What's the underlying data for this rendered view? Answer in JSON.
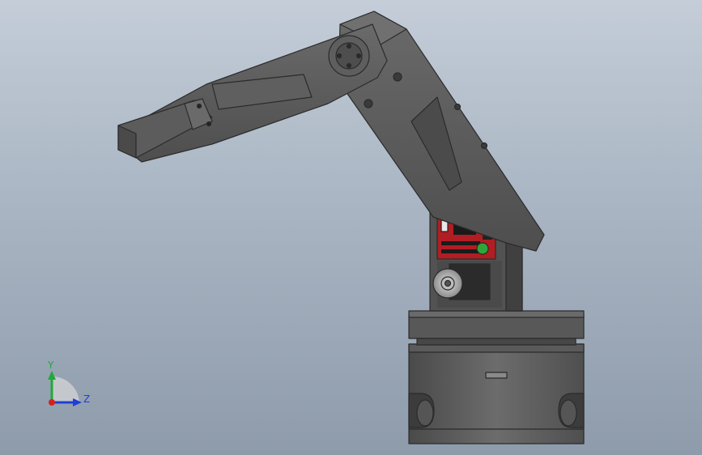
{
  "viewport": {
    "background_top": "#c4cdd8",
    "background_bottom": "#8e9bab"
  },
  "model": {
    "body_color": "#5b5b5b",
    "pcb_color": "#b01e23",
    "led_color": "#2fa83a"
  },
  "triad": {
    "y_label": "Y",
    "z_label": "Z",
    "y_color": "#22a83a",
    "z_color": "#1f3fd6",
    "x_color": "#d42020"
  }
}
